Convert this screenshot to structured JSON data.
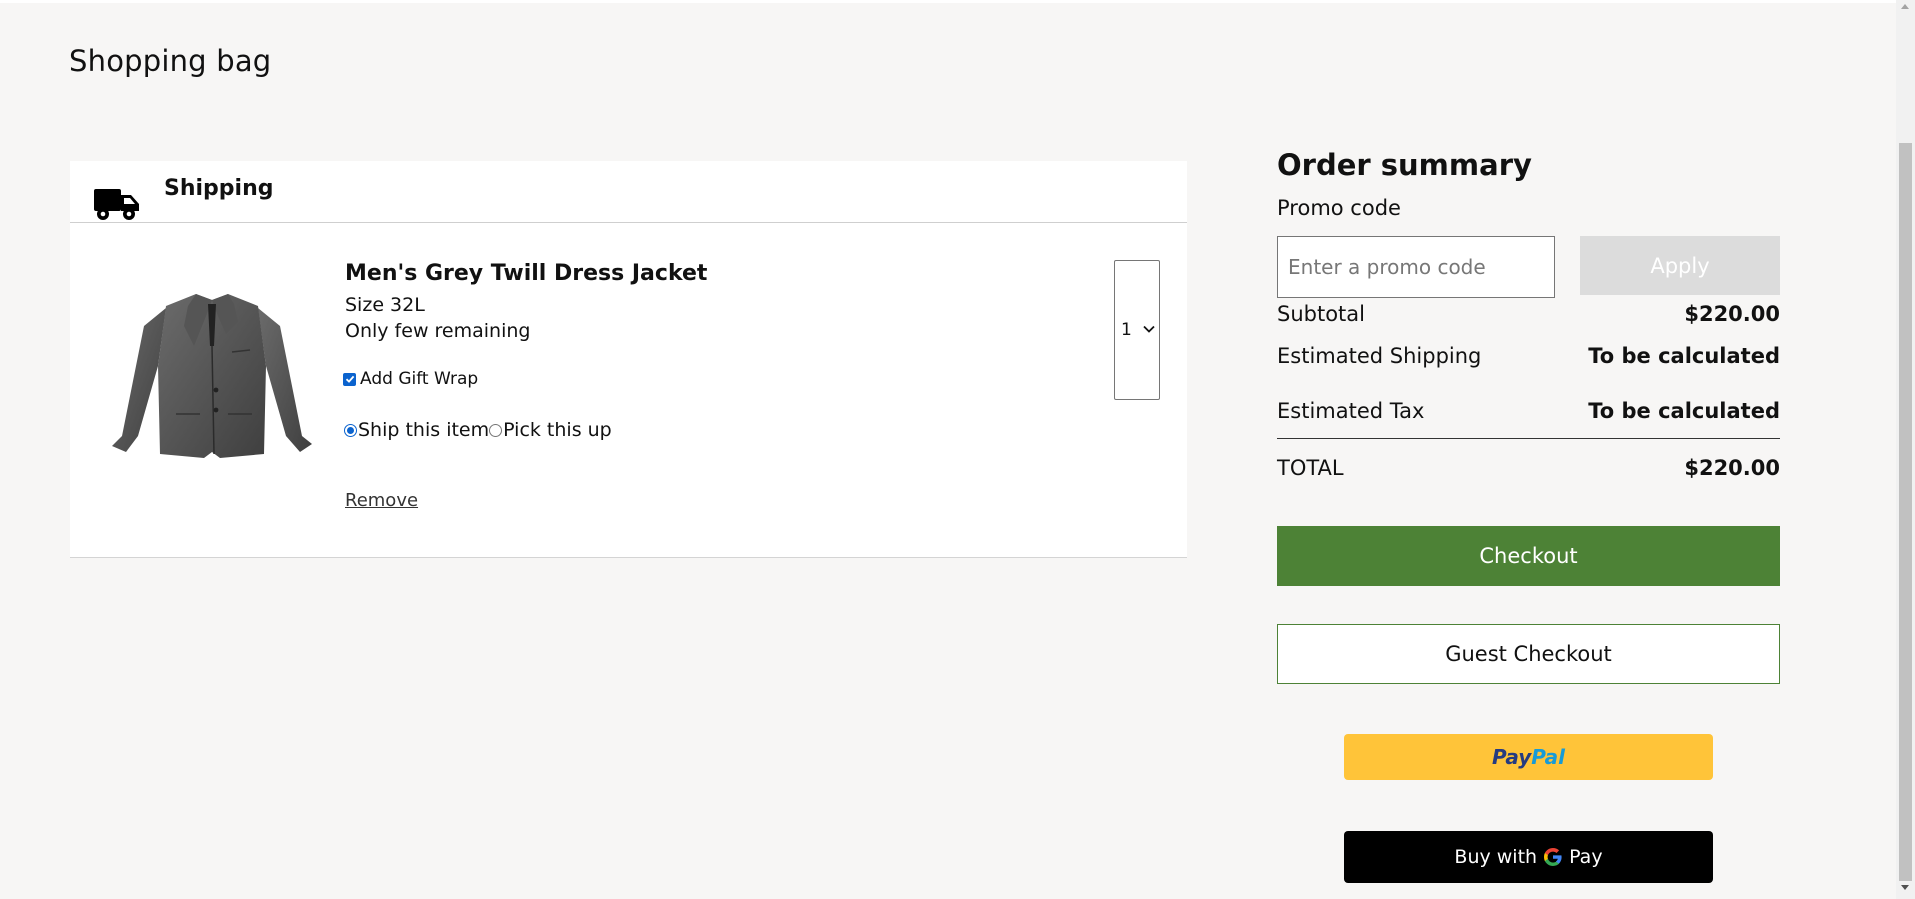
{
  "page": {
    "title": "Shopping bag"
  },
  "cart": {
    "section_label": "Shipping",
    "section_icon": "truck-icon",
    "item": {
      "name": "Men's Grey Twill Dress Jacket",
      "size": "Size 32L",
      "stock_note": "Only few remaining",
      "gift_wrap_label": "Add Gift Wrap",
      "gift_wrap_checked": true,
      "fulfillment_options": [
        "Ship this item",
        "Pick this up"
      ],
      "fulfillment_selected": "Ship this item",
      "remove_label": "Remove",
      "quantity": "1",
      "image_icon": "jacket-image"
    }
  },
  "summary": {
    "title": "Order summary",
    "promo_label": "Promo code",
    "promo_placeholder": "Enter a promo code",
    "promo_value": "",
    "apply_label": "Apply",
    "subtotal_label": "Subtotal",
    "subtotal_value": "$220.00",
    "shipping_label": "Estimated Shipping",
    "shipping_value": "To be calculated",
    "tax_label": "Estimated Tax",
    "tax_value": "To be calculated",
    "total_label": "TOTAL",
    "total_value": "$220.00",
    "checkout_label": "Checkout",
    "guest_checkout_label": "Guest Checkout",
    "paypal_label_1": "Pay",
    "paypal_label_2": "Pal",
    "gpay_prefix": "Buy with",
    "gpay_suffix": "Pay"
  },
  "colors": {
    "background": "#f7f6f5",
    "checkout_green": "#4d8236",
    "apply_disabled": "#dcdcdc",
    "paypal_yellow": "#ffc439",
    "paypal_dark_blue": "#253b80",
    "paypal_light_blue": "#179bd7",
    "gpay_black": "#000000",
    "control_blue": "#0b63ce"
  }
}
